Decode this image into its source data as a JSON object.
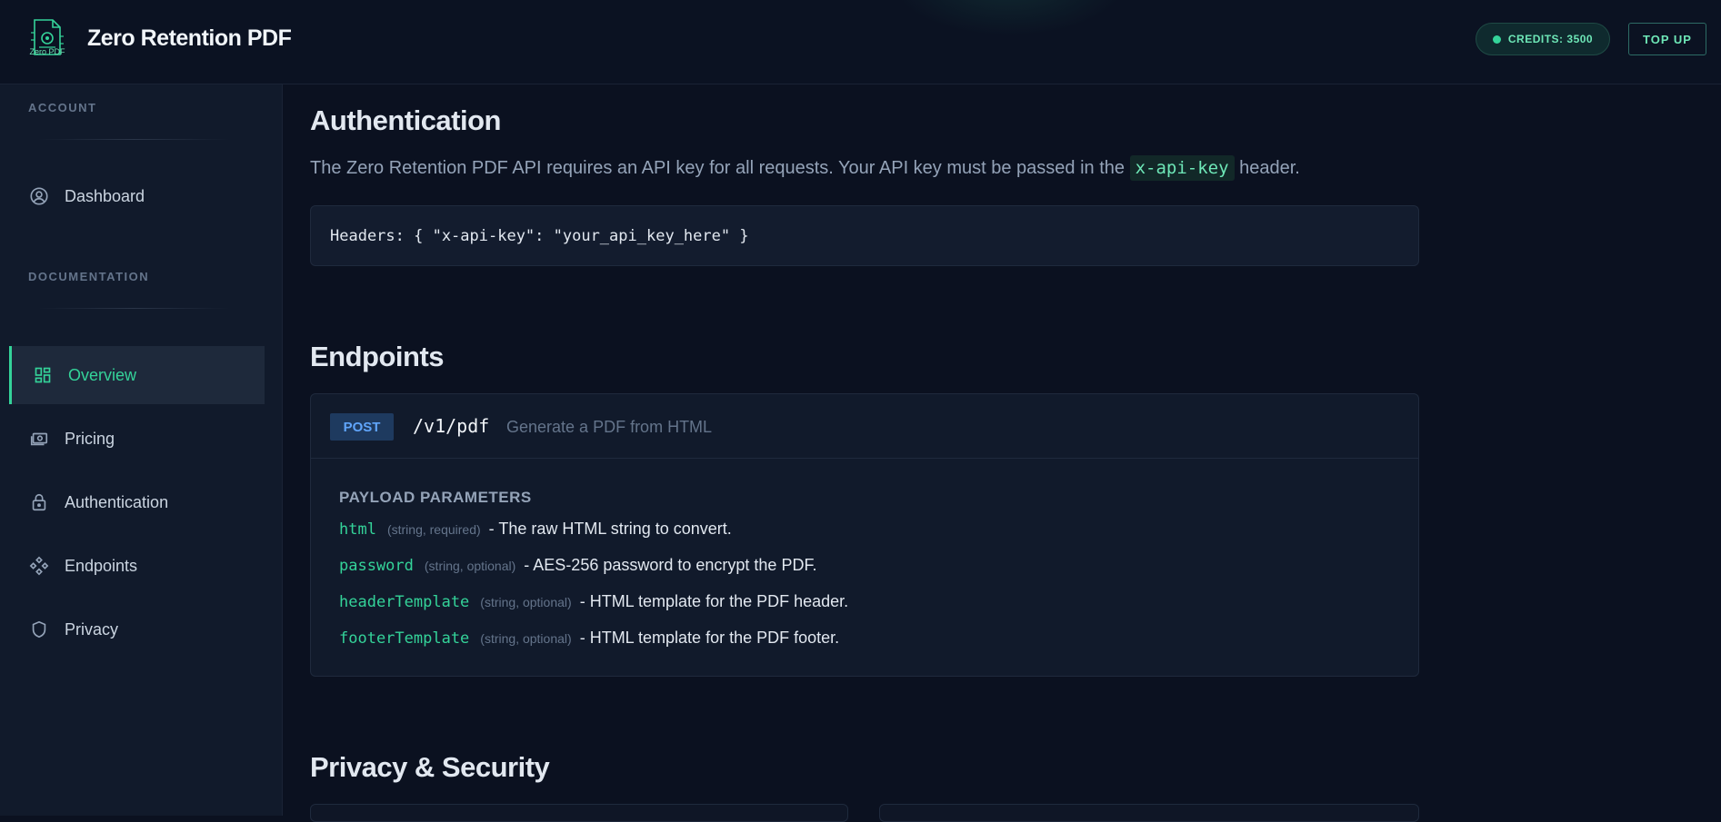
{
  "header": {
    "logo_text": "Zero PDF",
    "title": "Zero Retention PDF",
    "credits_label": "CREDITS: 3500",
    "topup_label": "TOP UP"
  },
  "sidebar": {
    "account_label": "ACCOUNT",
    "documentation_label": "DOCUMENTATION",
    "items": [
      {
        "label": "Dashboard",
        "icon": "user-circle-icon"
      },
      {
        "label": "Overview",
        "icon": "grid-icon",
        "active": true
      },
      {
        "label": "Pricing",
        "icon": "money-icon"
      },
      {
        "label": "Authentication",
        "icon": "lock-icon"
      },
      {
        "label": "Endpoints",
        "icon": "diamond-nodes-icon"
      },
      {
        "label": "Privacy",
        "icon": "shield-icon"
      }
    ]
  },
  "auth": {
    "heading": "Authentication",
    "text_before": "The Zero Retention PDF API requires an API key for all requests. Your API key must be passed in the ",
    "code": "x-api-key",
    "text_after": " header.",
    "code_block": "Headers: { \"x-api-key\": \"your_api_key_here\" }"
  },
  "endpoints": {
    "heading": "Endpoints",
    "method": "POST",
    "path": "/v1/pdf",
    "description": "Generate a PDF from HTML",
    "payload_title": "PAYLOAD PARAMETERS",
    "params": [
      {
        "name": "html",
        "type": "(string, required)",
        "desc": "- The raw HTML string to convert."
      },
      {
        "name": "password",
        "type": "(string, optional)",
        "desc": "- AES-256 password to encrypt the PDF."
      },
      {
        "name": "headerTemplate",
        "type": "(string, optional)",
        "desc": "- HTML template for the PDF header."
      },
      {
        "name": "footerTemplate",
        "type": "(string, optional)",
        "desc": "- HTML template for the PDF footer."
      }
    ]
  },
  "privacy": {
    "heading": "Privacy & Security"
  },
  "colors": {
    "accent": "#34d399",
    "background": "#0b1120",
    "sidebar": "#111a2b",
    "method_bg": "#1e3a5f"
  }
}
